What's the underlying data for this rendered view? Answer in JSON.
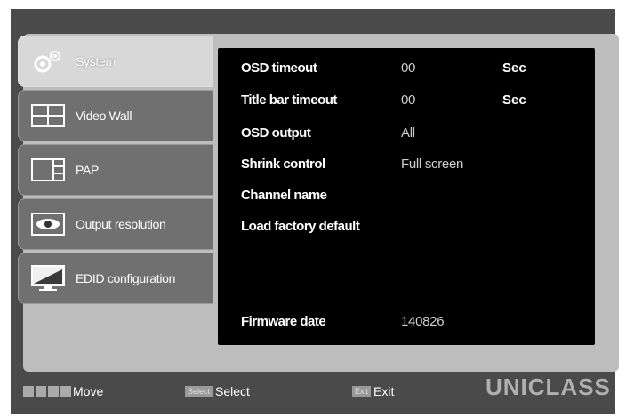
{
  "menu": {
    "tabs": [
      {
        "label": "System",
        "icon": "gears-icon",
        "active": true
      },
      {
        "label": "Video Wall",
        "icon": "video-wall-icon",
        "active": false
      },
      {
        "label": "PAP",
        "icon": "pap-icon",
        "active": false
      },
      {
        "label": "Output resolution",
        "icon": "eye-icon",
        "active": false
      },
      {
        "label": "EDID configuration",
        "icon": "monitor-icon",
        "active": false
      }
    ]
  },
  "settings": {
    "osd_timeout": {
      "label": "OSD timeout",
      "value": "00",
      "unit": "Sec"
    },
    "title_bar_timeout": {
      "label": "Title bar timeout",
      "value": "00",
      "unit": "Sec"
    },
    "osd_output": {
      "label": "OSD output",
      "value": "All"
    },
    "shrink_control": {
      "label": "Shrink control",
      "value": "Full screen"
    },
    "channel_name": {
      "label": "Channel name"
    },
    "load_factory_default": {
      "label": "Load factory default"
    },
    "firmware_date": {
      "label": "Firmware date",
      "value": "140826"
    }
  },
  "footer": {
    "move_label": "Move",
    "select_key": "Select",
    "select_label": "Select",
    "exit_key": "Exit",
    "exit_label": "Exit",
    "logo": "UNICLASS"
  }
}
